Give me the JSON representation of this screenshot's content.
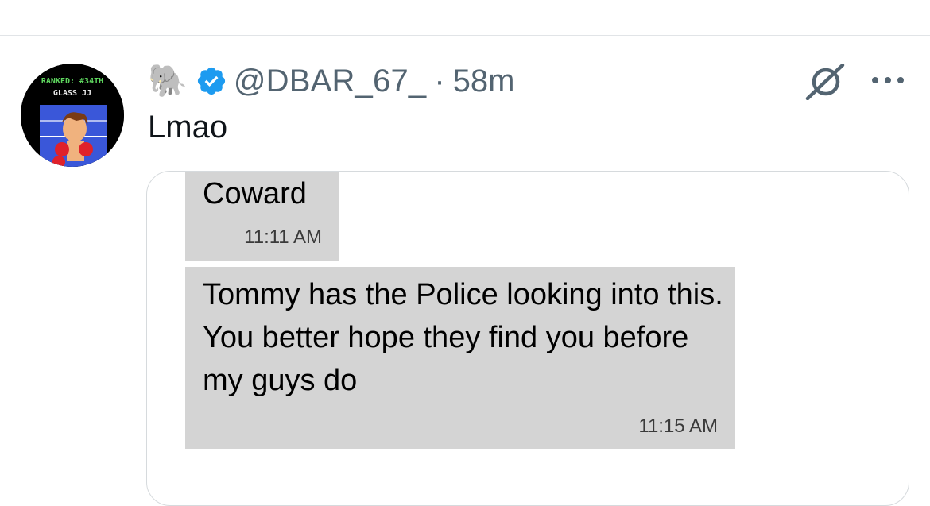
{
  "tweet": {
    "author_emoji": "🐘",
    "handle": "@DBAR_67_",
    "separator": "·",
    "time_ago": "58m",
    "text": "Lmao"
  },
  "avatar": {
    "rank_label": "RANKED: #34TH",
    "name_label": "GLASS JJ"
  },
  "screenshot_messages": [
    {
      "text": "Coward",
      "time": "11:11 AM"
    },
    {
      "text": "Tommy has the Police looking into this. You better hope they find you before my guys do",
      "time": "11:15 AM"
    }
  ],
  "colors": {
    "verified_badge": "#1d9bf0",
    "secondary_text": "#536471",
    "bubble_bg": "#d4d4d4",
    "avatar_rank_text": "#5ed65e",
    "avatar_ring_blue": "#3a57d9"
  },
  "icons": [
    "verified-badge-icon",
    "grok-icon",
    "more-options-icon"
  ]
}
